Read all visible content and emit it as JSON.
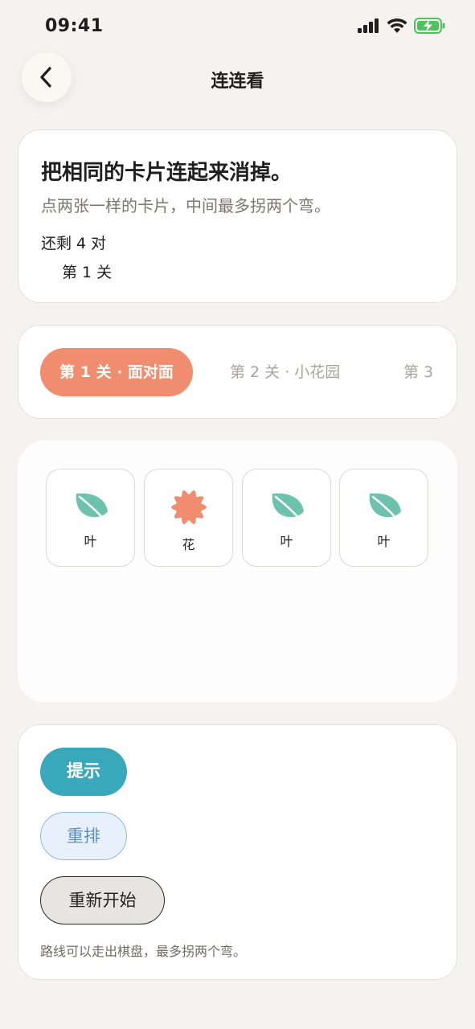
{
  "status_bar": {
    "time": "09:41"
  },
  "nav": {
    "title": "连连看"
  },
  "intro": {
    "title": "把相同的卡片连起来消掉。",
    "subtitle": "点两张一样的卡片，中间最多拐两个弯。",
    "remaining": "还剩 4 对",
    "level": "第 1 关"
  },
  "tabs": [
    {
      "label": "第 1 关 · 面对面",
      "active": true
    },
    {
      "label": "第 2 关 · 小花园",
      "active": false
    },
    {
      "label": "第 3",
      "active": false
    }
  ],
  "board": {
    "tiles": [
      {
        "label": "叶",
        "icon": "leaf-icon",
        "color": "#6cc2ad"
      },
      {
        "label": "花",
        "icon": "flower-icon",
        "color": "#ef8d6e"
      },
      {
        "label": "叶",
        "icon": "leaf-icon",
        "color": "#6cc2ad"
      },
      {
        "label": "叶",
        "icon": "leaf-icon",
        "color": "#6cc2ad"
      }
    ]
  },
  "controls": {
    "hint_label": "提示",
    "shuffle_label": "重排",
    "restart_label": "重新开始",
    "note": "路线可以走出棋盘，最多拐两个弯。"
  },
  "colors": {
    "accent": "#ef8d6e",
    "hint": "#3aa8bb",
    "leaf": "#6cc2ad",
    "background": "#f5f3ef"
  }
}
